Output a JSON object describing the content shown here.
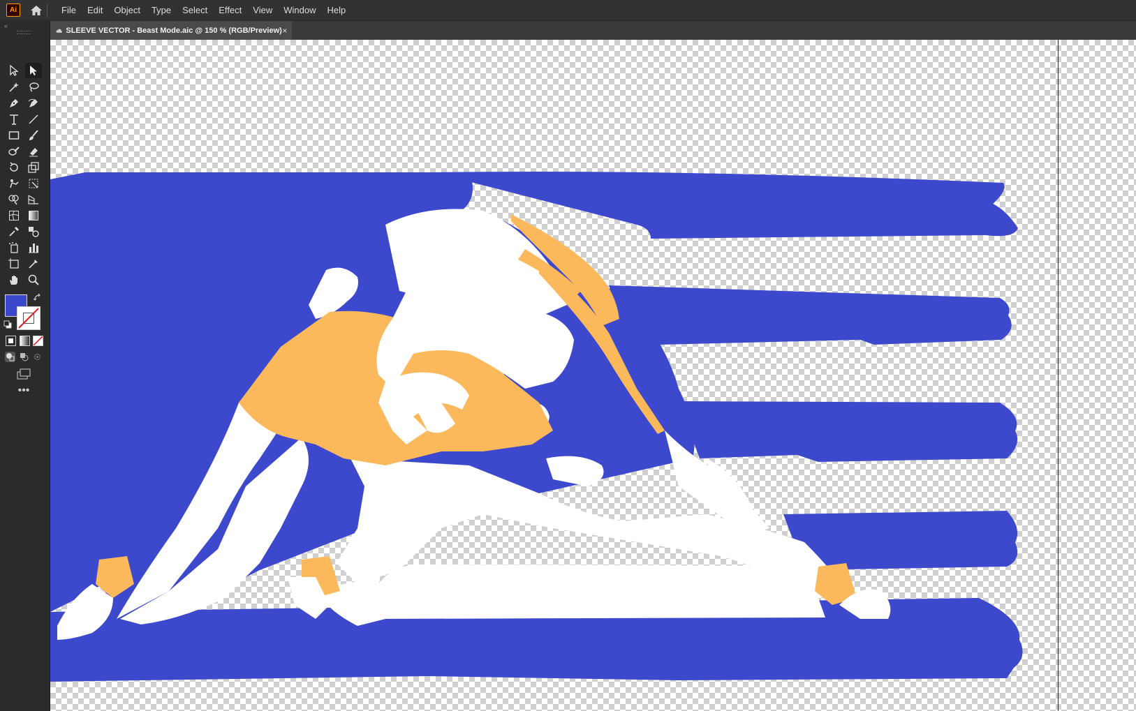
{
  "app": {
    "logo_text": "Ai",
    "home_icon": "home-icon"
  },
  "menu": [
    "File",
    "Edit",
    "Object",
    "Type",
    "Select",
    "Effect",
    "View",
    "Window",
    "Help"
  ],
  "document": {
    "tab_title": "SLEEVE VECTOR - Beast Mode.aic @ 150 % (RGB/Preview)",
    "close_symbol": "×",
    "cloud_icon": "cloud-document-icon"
  },
  "toolbar": {
    "collapse_symbol": "«",
    "tools": [
      "selection-tool-icon",
      "direct-selection-tool-icon",
      "magic-wand-tool-icon",
      "lasso-tool-icon",
      "pen-tool-icon",
      "curvature-tool-icon",
      "type-tool-icon",
      "line-segment-tool-icon",
      "rectangle-tool-icon",
      "paintbrush-tool-icon",
      "shaper-tool-icon",
      "eraser-tool-icon",
      "rotate-tool-icon",
      "scale-tool-icon",
      "puppet-warp-tool-icon",
      "free-transform-tool-icon",
      "shape-builder-tool-icon",
      "perspective-grid-tool-icon",
      "mesh-tool-icon",
      "gradient-tool-icon",
      "eyedropper-tool-icon",
      "blend-tool-icon",
      "symbol-sprayer-tool-icon",
      "column-graph-tool-icon",
      "artboard-tool-icon",
      "slice-tool-icon",
      "hand-tool-icon",
      "zoom-tool-icon"
    ],
    "fill_color": "#3b48cc",
    "stroke_color": "none",
    "more_tools_symbol": "•••"
  },
  "artwork": {
    "flag_blue": "#3d49cc",
    "accent_orange": "#fbb95c",
    "white": "#ffffff"
  }
}
